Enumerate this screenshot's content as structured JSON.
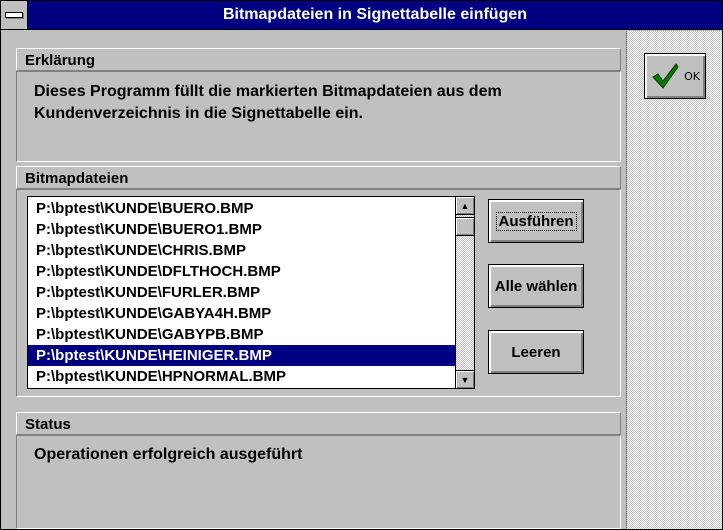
{
  "window": {
    "title": "Bitmapdateien in Signettabelle einfügen"
  },
  "ok_button": {
    "label": "OK",
    "icon": "checkmark-icon",
    "icon_color": "#008000"
  },
  "explanation": {
    "header": "Erklärung",
    "text_line1": "Dieses Programm füllt die markierten Bitmapdateien aus dem",
    "text_line2": "Kundenverzeichnis in die Signettabelle ein."
  },
  "files": {
    "header": "Bitmapdateien",
    "items": [
      "P:\\bptest\\KUNDE\\BUERO.BMP",
      "P:\\bptest\\KUNDE\\BUERO1.BMP",
      "P:\\bptest\\KUNDE\\CHRIS.BMP",
      "P:\\bptest\\KUNDE\\DFLTHOCH.BMP",
      "P:\\bptest\\KUNDE\\FURLER.BMP",
      "P:\\bptest\\KUNDE\\GABYA4H.BMP",
      "P:\\bptest\\KUNDE\\GABYPB.BMP",
      "P:\\bptest\\KUNDE\\HEINIGER.BMP",
      "P:\\bptest\\KUNDE\\HPNORMAL.BMP"
    ],
    "selected_index": 7
  },
  "actions": {
    "execute_label": "Ausführen",
    "select_all_label": "Alle wählen",
    "clear_label": "Leeren"
  },
  "status": {
    "header": "Status",
    "text": "Operationen erfolgreich ausgeführt"
  },
  "colors": {
    "titlebar": "#000080",
    "selection": "#000080",
    "face": "#c0c0c0"
  }
}
